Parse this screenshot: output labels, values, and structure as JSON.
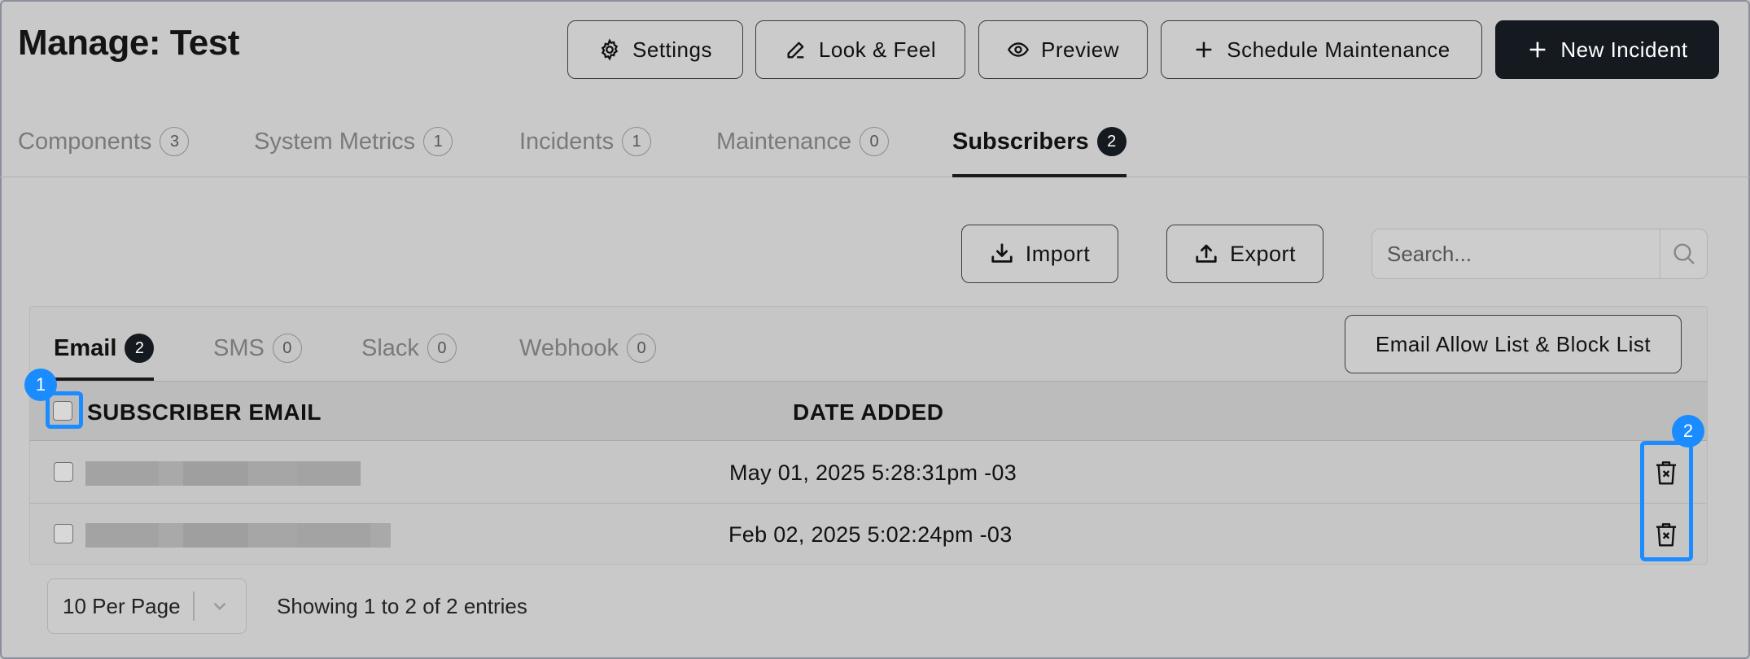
{
  "header": {
    "title": "Manage: Test",
    "buttons": {
      "settings": "Settings",
      "look_feel": "Look & Feel",
      "preview": "Preview",
      "schedule": "Schedule Maintenance",
      "new_incident": "New Incident"
    }
  },
  "tabs": [
    {
      "label": "Components",
      "count": "3"
    },
    {
      "label": "System Metrics",
      "count": "1"
    },
    {
      "label": "Incidents",
      "count": "1"
    },
    {
      "label": "Maintenance",
      "count": "0"
    },
    {
      "label": "Subscribers",
      "count": "2",
      "active": true
    }
  ],
  "actions": {
    "import": "Import",
    "export": "Export",
    "search_placeholder": "Search..."
  },
  "subtabs": [
    {
      "label": "Email",
      "count": "2",
      "active": true
    },
    {
      "label": "SMS",
      "count": "0"
    },
    {
      "label": "Slack",
      "count": "0"
    },
    {
      "label": "Webhook",
      "count": "0"
    }
  ],
  "allow_block_button": "Email Allow List & Block List",
  "table": {
    "headers": {
      "email": "SUBSCRIBER EMAIL",
      "date": "DATE ADDED"
    },
    "rows": [
      {
        "email": "",
        "date": "May 01, 2025 5:28:31pm -03"
      },
      {
        "email": "",
        "date": "Feb 02, 2025 5:02:24pm -03"
      }
    ]
  },
  "pagination": {
    "per_page": "10 Per Page",
    "entries": "Showing 1 to 2 of 2 entries"
  },
  "markers": {
    "m1": "1",
    "m2": "2"
  },
  "colors": {
    "highlight": "#1a8cff",
    "primary": "#151a20"
  }
}
